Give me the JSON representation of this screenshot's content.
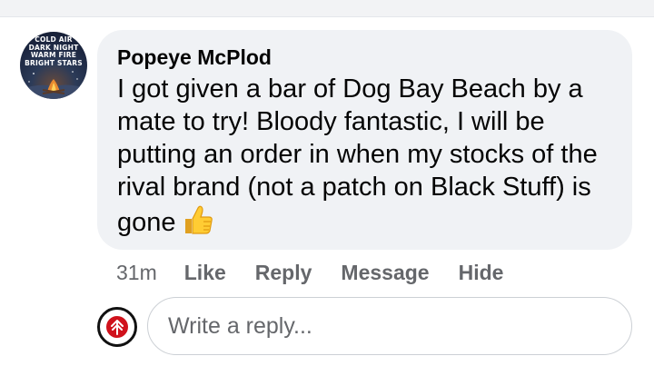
{
  "comment": {
    "author": "Popeye McPlod",
    "text": "I got given a bar of Dog Bay Beach by a mate to try! Bloody fantastic, I will be putting an order in when my stocks of the rival brand (not a patch on Black Stuff) is gone",
    "emoji": "thumbs-up-icon",
    "avatar_lines": [
      "COLD AIR",
      "DARK NIGHT",
      "WARM FIRE",
      "BRIGHT STARS"
    ]
  },
  "actions": {
    "time": "31m",
    "like": "Like",
    "reply": "Reply",
    "message": "Message",
    "hide": "Hide"
  },
  "reply_box": {
    "placeholder": "Write a reply...",
    "value": ""
  },
  "colors": {
    "bubble_bg": "#f0f2f5",
    "text": "#050505",
    "secondary_text": "#65676b",
    "input_border": "#ccd0d5",
    "user_avatar_accent": "#d0121c"
  }
}
